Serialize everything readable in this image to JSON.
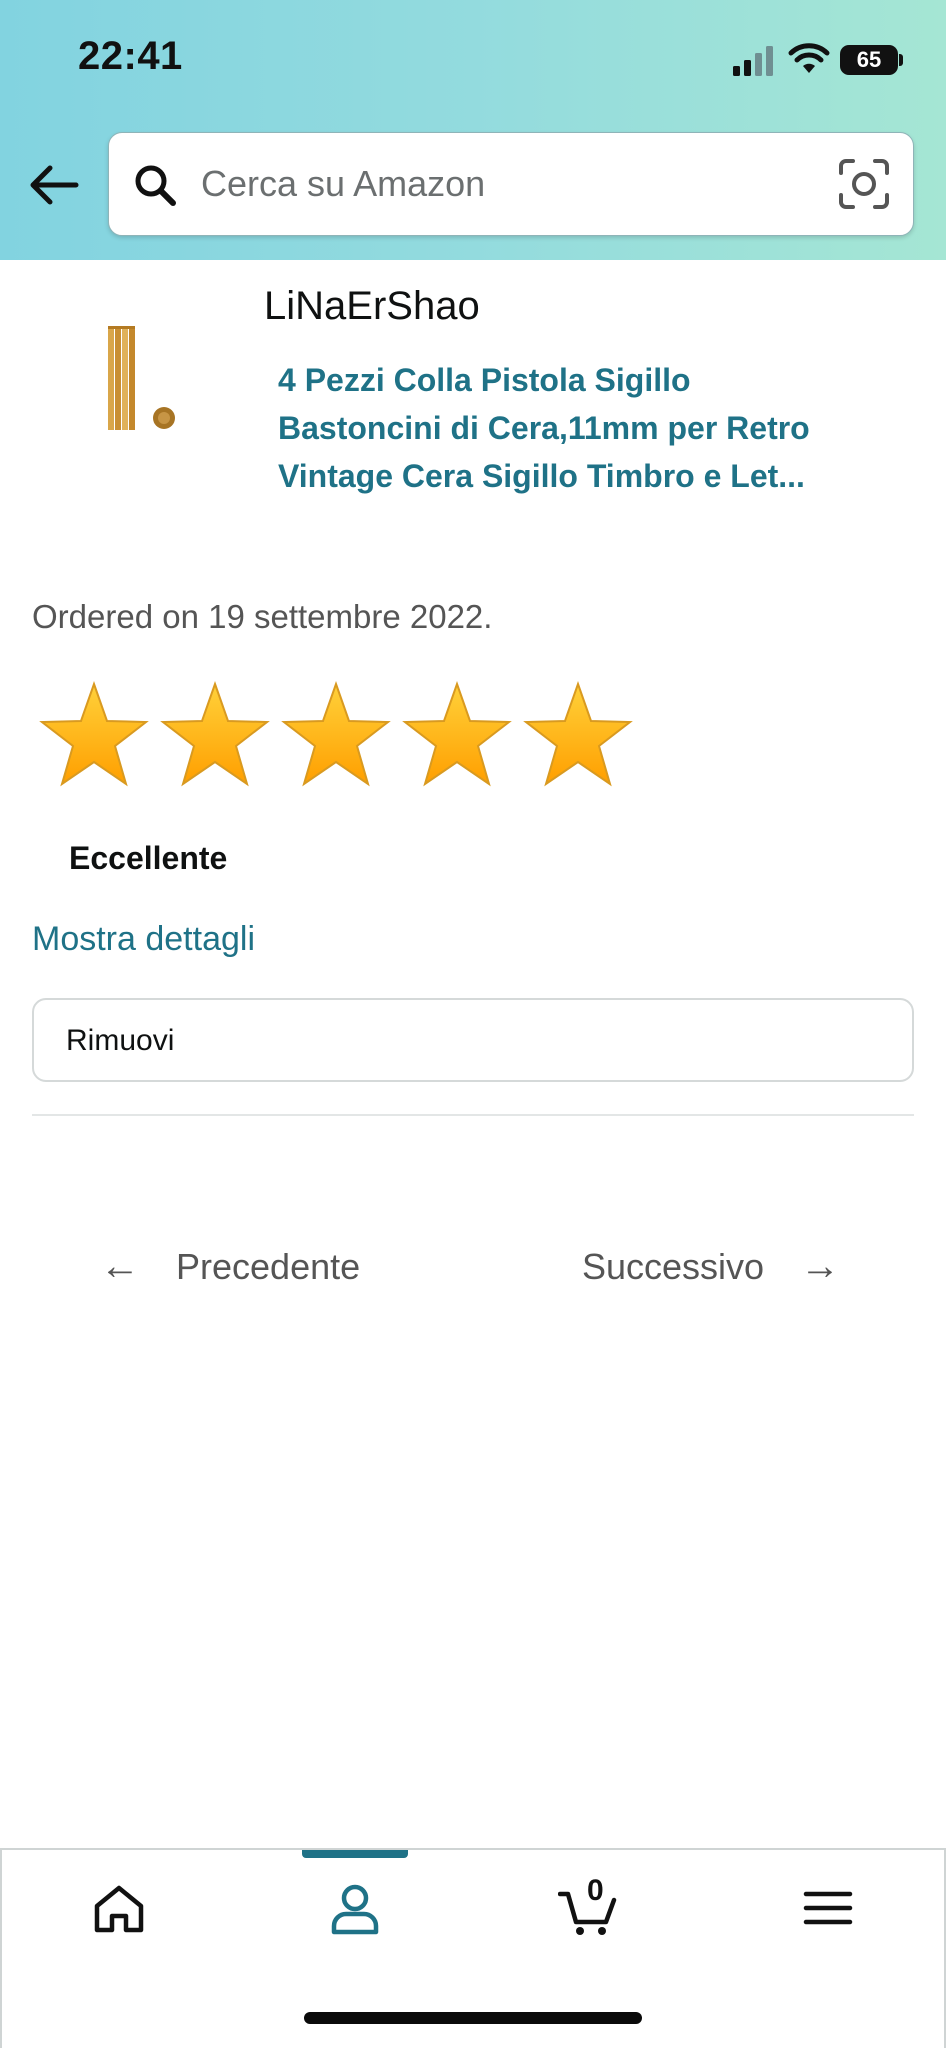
{
  "status_bar": {
    "time": "22:41",
    "battery": "65"
  },
  "search": {
    "placeholder": "Cerca su Amazon"
  },
  "product": {
    "seller": "LiNaErShao",
    "title": "4 Pezzi Colla Pistola Sigillo Bastoncini di Cera,11mm per Retro Vintage Cera Sigillo Timbro e Let...",
    "ordered_text": "Ordered on 19 settembre 2022."
  },
  "rating": {
    "stars": 5,
    "max_stars": 5,
    "label": "Eccellente"
  },
  "actions": {
    "details_link": "Mostra dettagli",
    "remove_label": "Rimuovi"
  },
  "pager": {
    "prev_arrow": "←",
    "prev_label": "Precedente",
    "next_label": "Successivo",
    "next_arrow": "→"
  },
  "tabbar": {
    "cart_count": "0",
    "active_tab": "account"
  },
  "colors": {
    "accent": "#1f7287",
    "star": "#ffb400"
  }
}
